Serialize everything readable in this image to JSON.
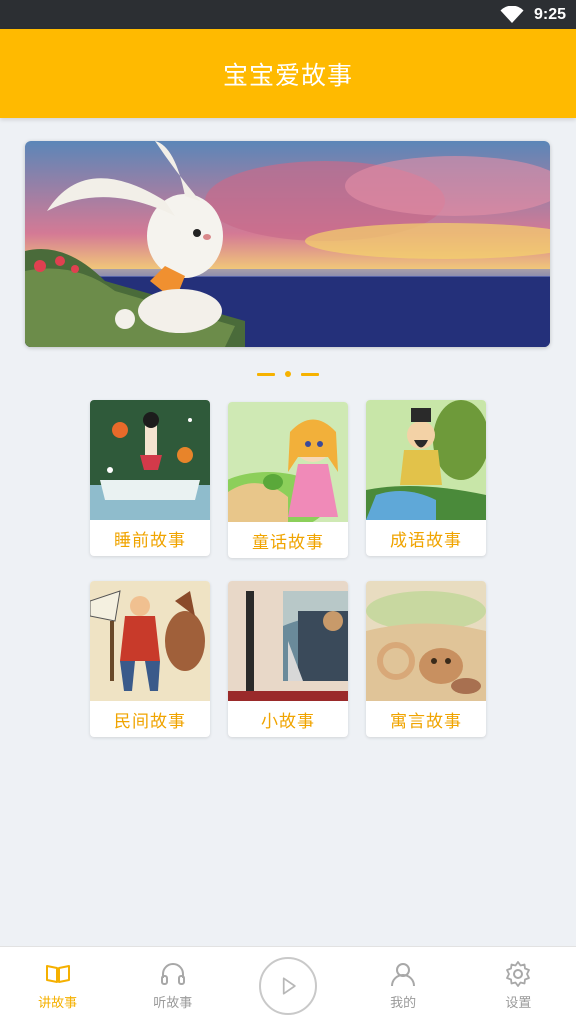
{
  "status_bar": {
    "time": "9:25",
    "wifi_icon": "wifi-icon"
  },
  "app_bar": {
    "title": "宝宝爱故事"
  },
  "banner": {
    "image": "rabbit-sunset-illustration",
    "page_indicator": {
      "count": 3,
      "active": 2
    }
  },
  "categories": [
    {
      "label": "睡前故事",
      "image": "bedtime-story-thumb"
    },
    {
      "label": "童话故事",
      "image": "fairy-tale-thumb"
    },
    {
      "label": "成语故事",
      "image": "idiom-story-thumb"
    },
    {
      "label": "民间故事",
      "image": "folk-story-thumb"
    },
    {
      "label": "小故事",
      "image": "short-story-thumb"
    },
    {
      "label": "寓言故事",
      "image": "fable-thumb"
    }
  ],
  "tabs": [
    {
      "label": "讲故事",
      "icon": "book-icon",
      "active": true
    },
    {
      "label": "听故事",
      "icon": "headphones-icon",
      "active": false
    },
    {
      "label": "",
      "icon": "play-icon",
      "active": false
    },
    {
      "label": "我的",
      "icon": "user-icon",
      "active": false
    },
    {
      "label": "设置",
      "icon": "gear-icon",
      "active": false
    }
  ],
  "colors": {
    "accent": "#ffba00",
    "label": "#f0a400",
    "background": "#eef1f5",
    "status_bar": "#2c2f33"
  }
}
